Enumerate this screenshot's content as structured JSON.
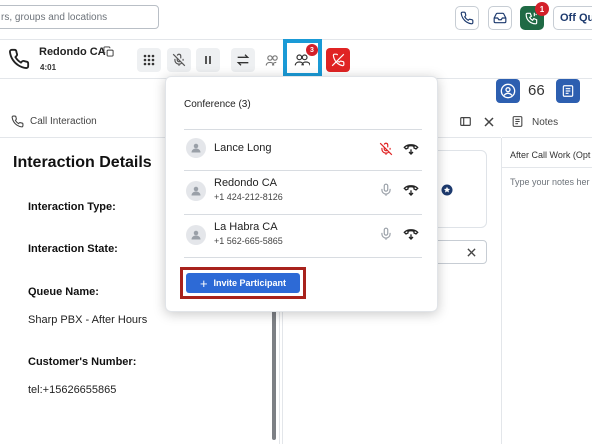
{
  "topbar": {
    "search_placeholder": "rs, groups and locations",
    "notification_count": "1",
    "status_label": "Off Qu"
  },
  "call": {
    "name": "Redondo CA",
    "duration": "4:01",
    "conference_count": "3"
  },
  "left_panel": {
    "header": "Call Interaction",
    "title": "Interaction Details",
    "fields": {
      "interaction_type_label": "Interaction Type:",
      "interaction_state_label": "Interaction State:",
      "queue_name_label": "Queue Name:",
      "queue_name_value": "Sharp PBX - After Hours",
      "customer_number_label": "Customer's Number:",
      "customer_number_value": "tel:+15626655865"
    }
  },
  "right_panel": {
    "queue_count": "66",
    "notes_title": "Notes",
    "after_call_work": "After Call Work (Opt",
    "notes_placeholder": "Type your notes her"
  },
  "conference": {
    "title": "Conference (3)",
    "participants": [
      {
        "name": "Lance Long",
        "phone": "",
        "muted": true
      },
      {
        "name": "Redondo CA",
        "phone": "+1 424-212-8126",
        "muted": false
      },
      {
        "name": "La Habra CA",
        "phone": "+1 562-665-5865",
        "muted": false
      }
    ],
    "invite_label": "Invite Participant"
  },
  "colors": {
    "accent": "#2d6ad6",
    "highlight_blue": "#1a9ad6",
    "highlight_red": "#a8221c",
    "danger": "#e02424",
    "presence_green": "#1f6a45"
  }
}
